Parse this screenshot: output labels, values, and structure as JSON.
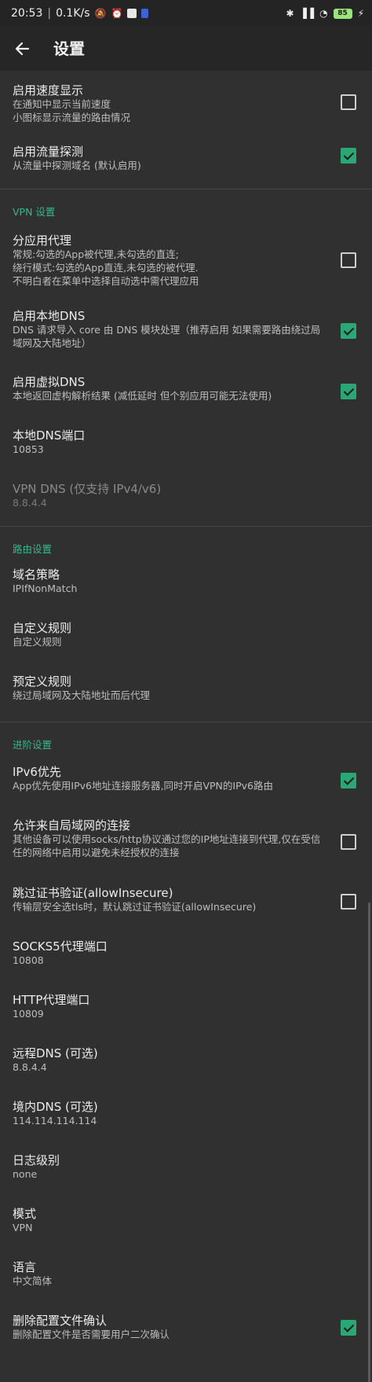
{
  "status_bar": {
    "time": "20:53",
    "speed": "0.1K/s",
    "battery": "85",
    "icons": [
      "dnd-off-icon",
      "alarm-icon",
      "app-icon",
      "app-icon-2",
      "bluetooth-icon",
      "signal-icon",
      "wifi-icon",
      "battery-icon",
      "charging-icon"
    ]
  },
  "app_bar": {
    "title": "设置",
    "back_icon": "arrow-left-icon"
  },
  "sections": {
    "general": [
      {
        "title": "启用速度显示",
        "summary": "在通知中显示当前速度\n小图标显示流量的路由情况",
        "checked": false
      },
      {
        "title": "启用流量探测",
        "summary": "从流量中探测域名 (默认启用)",
        "checked": true
      }
    ],
    "vpn": {
      "header": "VPN 设置",
      "items": [
        {
          "title": "分应用代理",
          "summary": "常规:勾选的App被代理,未勾选的直连;\n绕行模式:勾选的App直连,未勾选的被代理.\n不明白者在菜单中选择自动选中需代理应用",
          "checked": false
        },
        {
          "title": "启用本地DNS",
          "summary": "DNS 请求导入 core 由 DNS 模块处理（推荐启用 如果需要路由绕过局域网及大陆地址）",
          "checked": true
        },
        {
          "title": "启用虚拟DNS",
          "summary": "本地返回虚构解析结果 (减低延时 但个别应用可能无法使用)",
          "checked": true
        },
        {
          "title": "本地DNS端口",
          "summary": "10853"
        },
        {
          "title": "VPN DNS (仅支持 IPv4/v6)",
          "summary": "8.8.4.4"
        }
      ]
    },
    "routing": {
      "header": "路由设置",
      "items": [
        {
          "title": "域名策略",
          "summary": "IPIfNonMatch"
        },
        {
          "title": "自定义规则",
          "summary": "自定义规则"
        },
        {
          "title": "预定义规则",
          "summary": "绕过局域网及大陆地址而后代理"
        }
      ]
    },
    "advanced": {
      "header": "进阶设置",
      "items": [
        {
          "title": "IPv6优先",
          "summary": "App优先使用IPv6地址连接服务器,同时开启VPN的IPv6路由",
          "checked": true
        },
        {
          "title": "允许来自局域网的连接",
          "summary": "其他设备可以使用socks/http协议通过您的IP地址连接到代理,仅在受信任的网络中启用以避免未经授权的连接",
          "checked": false
        },
        {
          "title": "跳过证书验证(allowInsecure)",
          "summary": "传输层安全选tls时，默认跳过证书验证(allowInsecure)",
          "checked": false
        },
        {
          "title": "SOCKS5代理端口",
          "summary": "10808"
        },
        {
          "title": "HTTP代理端口",
          "summary": "10809"
        },
        {
          "title": "远程DNS (可选)",
          "summary": "8.8.4.4"
        },
        {
          "title": "境内DNS (可选)",
          "summary": "114.114.114.114"
        },
        {
          "title": "日志级别",
          "summary": "none"
        },
        {
          "title": "模式",
          "summary": "VPN"
        },
        {
          "title": "语言",
          "summary": "中文简体"
        },
        {
          "title": "删除配置文件确认",
          "summary": "删除配置文件是否需要用户二次确认",
          "checked": true
        }
      ]
    }
  }
}
